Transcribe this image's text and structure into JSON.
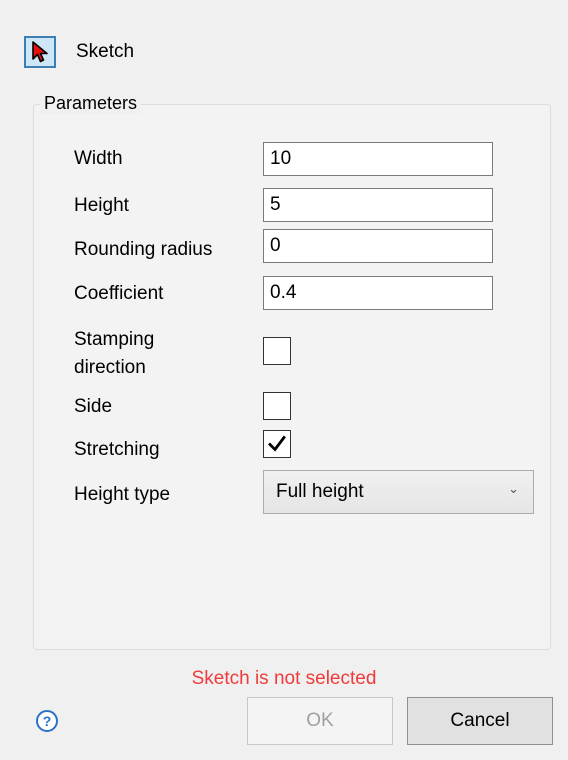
{
  "header": {
    "mode_label": "Sketch"
  },
  "parameters": {
    "legend": "Parameters",
    "width": {
      "label": "Width",
      "value": "10"
    },
    "height": {
      "label": "Height",
      "value": "5"
    },
    "rounding_radius": {
      "label": "Rounding radius",
      "value": "0"
    },
    "coefficient": {
      "label": "Coefficient",
      "value": "0.4"
    },
    "stamping_direction": {
      "label_line1": "Stamping",
      "label_line2": "direction",
      "checked": false
    },
    "side": {
      "label": "Side",
      "checked": false
    },
    "stretching": {
      "label": "Stretching",
      "checked": true
    },
    "height_type": {
      "label": "Height type",
      "selected": "Full height"
    }
  },
  "status": {
    "message": "Sketch is not selected",
    "color": "#ef3b3b"
  },
  "footer": {
    "help_symbol": "?",
    "ok_label": "OK",
    "cancel_label": "Cancel"
  },
  "icons": [
    "cursor-arrow-icon",
    "checkmark-icon",
    "chevron-down-icon",
    "help-icon"
  ],
  "colors": {
    "accent": "#3c7fb1",
    "help": "#2a72c8"
  }
}
